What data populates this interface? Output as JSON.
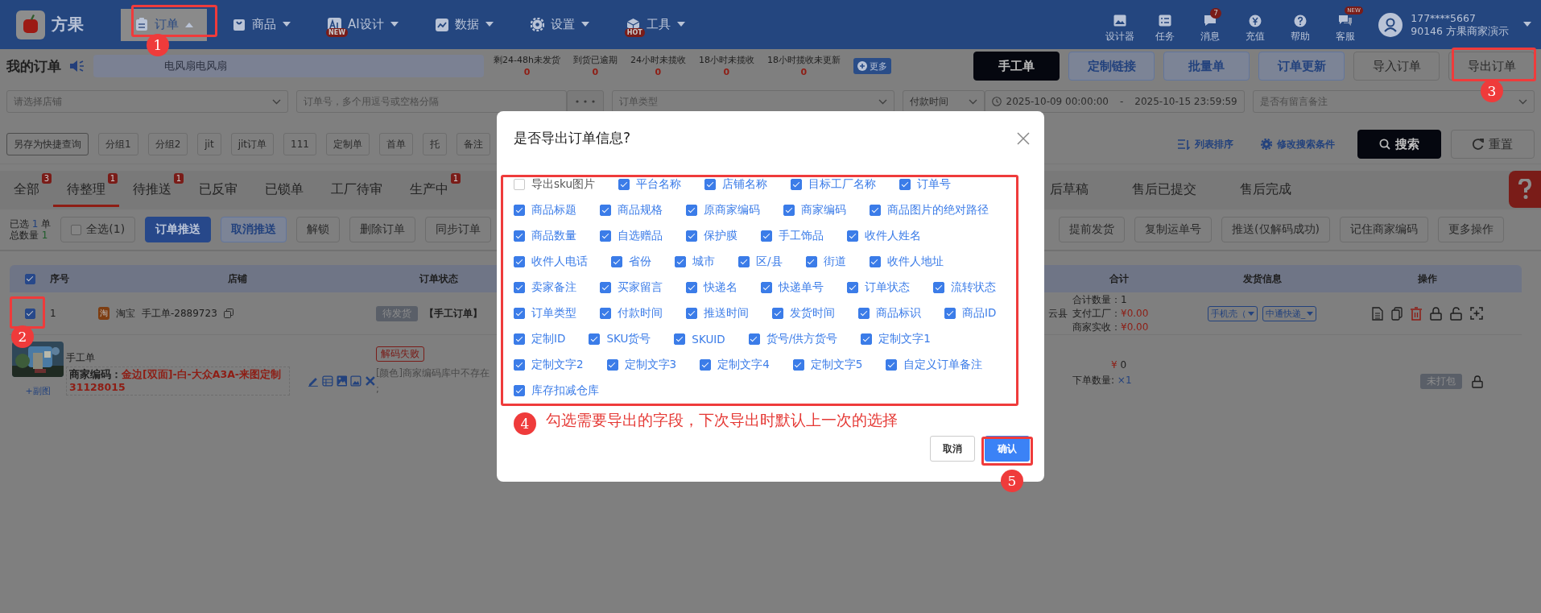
{
  "nav": {
    "logo": "方果",
    "items": [
      {
        "label": "订单",
        "selected": true
      },
      {
        "label": "商品",
        "selected": false
      },
      {
        "label": "AI设计",
        "selected": false,
        "badge": "NEW"
      },
      {
        "label": "数据",
        "selected": false
      },
      {
        "label": "设置",
        "selected": false
      },
      {
        "label": "工具",
        "selected": false,
        "badge": "HOT"
      }
    ],
    "tools": [
      {
        "label": "设计器"
      },
      {
        "label": "任务"
      },
      {
        "label": "消息",
        "count": "7"
      },
      {
        "label": "充值"
      },
      {
        "label": "帮助"
      },
      {
        "label": "客服",
        "badge": "NEW"
      }
    ],
    "user": {
      "phone": "177****5667",
      "name": "90146 方果商家演示"
    }
  },
  "page_header": {
    "title": "我的订单",
    "notice": "电风扇电风扇",
    "stats": [
      {
        "label": "剩24-48h未发货",
        "value": "0"
      },
      {
        "label": "到货已逾期",
        "value": "0"
      },
      {
        "label": "24小时未揽收",
        "value": "0"
      },
      {
        "label": "18小时未揽收",
        "value": "0"
      },
      {
        "label": "18小时揽收未更新",
        "value": "0"
      }
    ],
    "more": "更多",
    "buttons": [
      {
        "label": "手工单",
        "kind": "dark"
      },
      {
        "label": "定制链接",
        "kind": "accent"
      },
      {
        "label": "批量单",
        "kind": "accent"
      },
      {
        "label": "订单更新",
        "kind": "accent"
      },
      {
        "label": "导入订单",
        "kind": "plain"
      },
      {
        "label": "导出订单",
        "kind": "plain"
      }
    ]
  },
  "filters": [
    {
      "kind": "select",
      "placeholder": "请选择店铺"
    },
    {
      "kind": "input",
      "placeholder": "订单号，多个用逗号或空格分隔"
    },
    {
      "kind": "more"
    },
    {
      "kind": "select",
      "placeholder": "订单类型"
    },
    {
      "kind": "select",
      "value": "付款时间"
    },
    {
      "kind": "date_range",
      "start": "2025-10-09 00:00:00",
      "separator": "-",
      "end": "2025-10-15 23:59:59"
    },
    {
      "kind": "select",
      "placeholder": "是否有留言备注"
    }
  ],
  "quick_tags": {
    "save": "另存为快捷查询",
    "tags": [
      "分组1",
      "分组2",
      "jit",
      "jit订单",
      "111",
      "定制单",
      "首单",
      "托",
      "备注"
    ],
    "sort": "列表排序",
    "edit_conditions": "修改搜索条件",
    "search": "搜索",
    "reset": "重置"
  },
  "tabs": {
    "left": [
      {
        "label": "全部",
        "badge": "3",
        "selected": false
      },
      {
        "label": "待整理",
        "badge": "1",
        "selected": true
      },
      {
        "label": "待推送",
        "badge": "1",
        "selected": false
      },
      {
        "label": "已反审",
        "selected": false
      },
      {
        "label": "已锁单",
        "selected": false
      },
      {
        "label": "工厂待审",
        "selected": false
      },
      {
        "label": "生产中",
        "badge": "1",
        "selected": false
      }
    ],
    "right": [
      {
        "label": "后草稿",
        "selected": false
      },
      {
        "label": "售后已提交",
        "selected": false
      },
      {
        "label": "售后完成",
        "selected": false
      }
    ]
  },
  "actions": {
    "selected_label": "已选",
    "selected_count": "1",
    "selected_unit": "单",
    "total_label": "总数量",
    "total": "1",
    "select_all": {
      "label": "全选(1)",
      "checked": false
    },
    "left": [
      {
        "label": "订单推送",
        "kind": "primary"
      },
      {
        "label": "取消推送",
        "kind": "accent"
      },
      {
        "label": "解锁",
        "kind": "plain"
      },
      {
        "label": "删除订单",
        "kind": "plain"
      },
      {
        "label": "同步订单",
        "kind": "plain"
      }
    ],
    "right": [
      {
        "label": "提前发货",
        "kind": "plain"
      },
      {
        "label": "复制运单号",
        "kind": "plain"
      },
      {
        "label": "推送(仅解码成功)",
        "kind": "plain"
      },
      {
        "label": "记住商家编码",
        "kind": "plain"
      },
      {
        "label": "更多操作",
        "kind": "plain"
      }
    ]
  },
  "table": {
    "columns": [
      "序号",
      "店铺",
      "订单状态",
      "合计",
      "发货信息",
      "操作"
    ],
    "all_checked": true,
    "order": {
      "checked": true,
      "index": "1",
      "shop_badge": "淘",
      "platform": "淘宝",
      "order_no": "手工单-2889723",
      "status": "待发货",
      "order_type": "【手工订单】",
      "region": "云县",
      "totals": [
        {
          "label": "合计数量：",
          "value": "1",
          "kind": "plain"
        },
        {
          "label": "支付工厂：",
          "value": "¥0.00",
          "kind": "money"
        },
        {
          "label": "商家实收：",
          "value": "¥0.00",
          "kind": "money"
        }
      ],
      "shipping": [
        "手机壳（",
        "中通快递_"
      ]
    },
    "item": {
      "name": "手工单",
      "code_label": "商家编码：",
      "code": "金边[双面]-白-大众A3A-来图定制31128015",
      "add_image": "+副图",
      "decode_status": "解码失败",
      "error": "[颜色]商家编码库中不存在",
      "error_tail": ";",
      "currency": "¥",
      "price": "0",
      "qty_label": "下单数量:",
      "qty": "×1",
      "pack_status": "未打包"
    }
  },
  "dialog": {
    "title": "是否导出订单信息?",
    "field_rows": [
      [
        {
          "label": "导出sku图片",
          "checked": false
        },
        {
          "label": "平台名称",
          "checked": true
        },
        {
          "label": "店铺名称",
          "checked": true
        },
        {
          "label": "目标工厂名称",
          "checked": true
        },
        {
          "label": "订单号",
          "checked": true
        }
      ],
      [
        {
          "label": "商品标题",
          "checked": true
        },
        {
          "label": "商品规格",
          "checked": true
        },
        {
          "label": "原商家编码",
          "checked": true
        },
        {
          "label": "商家编码",
          "checked": true
        },
        {
          "label": "商品图片的绝对路径",
          "checked": true
        }
      ],
      [
        {
          "label": "商品数量",
          "checked": true
        },
        {
          "label": "自选赠品",
          "checked": true
        },
        {
          "label": "保护膜",
          "checked": true
        },
        {
          "label": "手工饰品",
          "checked": true
        },
        {
          "label": "收件人姓名",
          "checked": true
        }
      ],
      [
        {
          "label": "收件人电话",
          "checked": true
        },
        {
          "label": "省份",
          "checked": true
        },
        {
          "label": "城市",
          "checked": true
        },
        {
          "label": "区/县",
          "checked": true
        },
        {
          "label": "街道",
          "checked": true
        },
        {
          "label": "收件人地址",
          "checked": true
        }
      ],
      [
        {
          "label": "卖家备注",
          "checked": true
        },
        {
          "label": "买家留言",
          "checked": true
        },
        {
          "label": "快递名",
          "checked": true
        },
        {
          "label": "快递单号",
          "checked": true
        },
        {
          "label": "订单状态",
          "checked": true
        },
        {
          "label": "流转状态",
          "checked": true
        }
      ],
      [
        {
          "label": "订单类型",
          "checked": true
        },
        {
          "label": "付款时间",
          "checked": true
        },
        {
          "label": "推送时间",
          "checked": true
        },
        {
          "label": "发货时间",
          "checked": true
        },
        {
          "label": "商品标识",
          "checked": true
        },
        {
          "label": "商品ID",
          "checked": true
        }
      ],
      [
        {
          "label": "定制ID",
          "checked": true
        },
        {
          "label": "SKU货号",
          "checked": true
        },
        {
          "label": "SKUID",
          "checked": true
        },
        {
          "label": "货号/供方货号",
          "checked": true
        },
        {
          "label": "定制文字1",
          "checked": true
        }
      ],
      [
        {
          "label": "定制文字2",
          "checked": true
        },
        {
          "label": "定制文字3",
          "checked": true
        },
        {
          "label": "定制文字4",
          "checked": true
        },
        {
          "label": "定制文字5",
          "checked": true
        },
        {
          "label": "自定义订单备注",
          "checked": true
        }
      ],
      [
        {
          "label": "库存扣减仓库",
          "checked": true
        }
      ]
    ],
    "note": "勾选需要导出的字段，下次导出时默认上一次的选择",
    "cancel": "取消",
    "confirm": "确认"
  },
  "annotations": [
    "1",
    "2",
    "3",
    "4",
    "5"
  ]
}
